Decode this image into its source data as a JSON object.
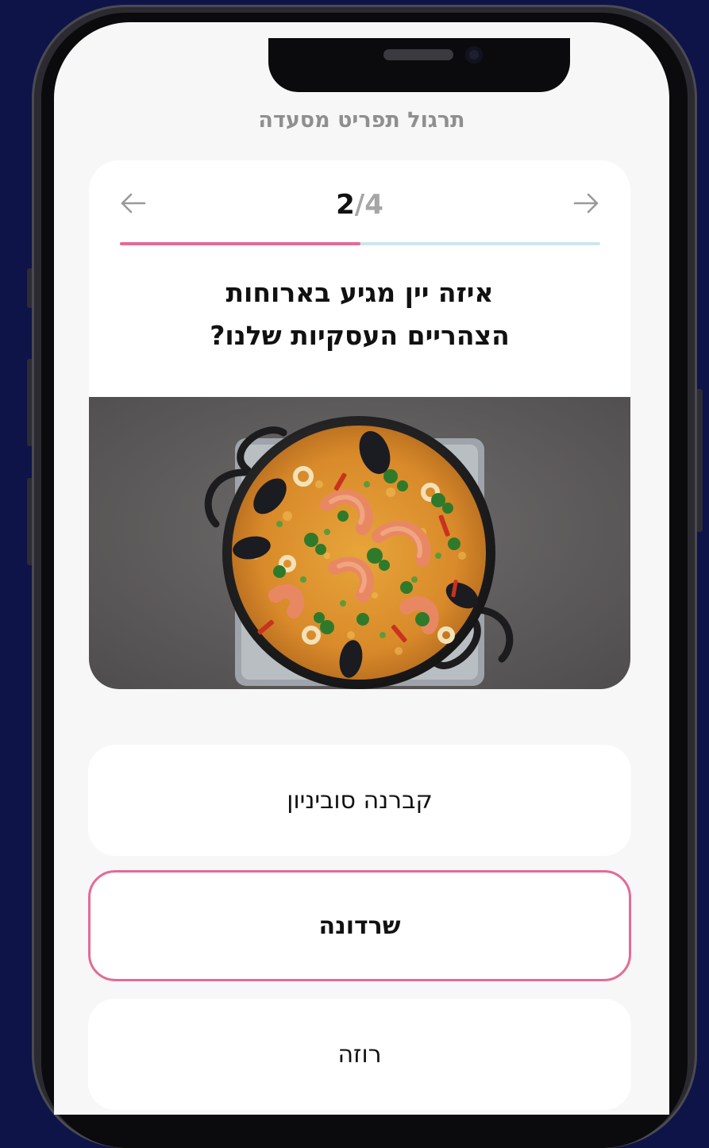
{
  "header": {
    "title": "תרגול תפריט מסעדה"
  },
  "quiz": {
    "current": "2",
    "separator": "/",
    "total": "4",
    "progress_fraction": 0.5,
    "question_line1": "איזה יין מגיע בארוחות",
    "question_line2": "הצהריים העסקיות שלנו?"
  },
  "answers": [
    {
      "label": "קברנה סוביניון",
      "selected": false
    },
    {
      "label": "שרדונה",
      "selected": true
    },
    {
      "label": "רוזה",
      "selected": false
    }
  ],
  "icons": {
    "prev": "arrow-left-icon",
    "next": "arrow-right-icon",
    "image": "paella-dish-image"
  },
  "colors": {
    "background": "#0e1348",
    "accent": "#e36b97",
    "progress_track": "#cfe5ee",
    "screen": "#f7f7f7"
  }
}
